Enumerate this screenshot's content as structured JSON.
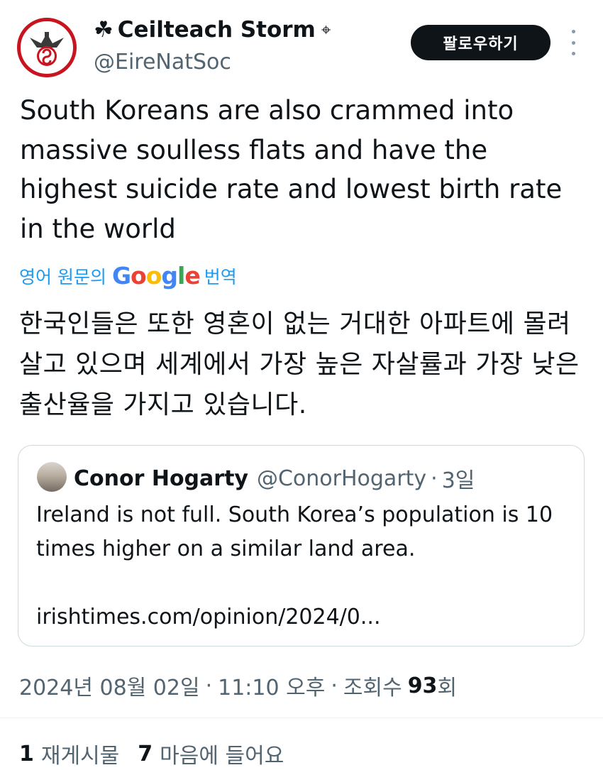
{
  "author": {
    "prefix_icon": "☘",
    "name": "Ceilteach Storm",
    "suffix_icon": "⌖",
    "handle": "@EireNatSoc"
  },
  "follow_button": {
    "label": "팔로우하기"
  },
  "tweet": {
    "text": "South Koreans are also crammed into massive soulless flats and have the highest suicide rate and lowest birth rate in the world",
    "translation_link": {
      "before": "영어 원문의",
      "brand": "Google",
      "after": "번역"
    },
    "translated_text": "한국인들은 또한 영혼이 없는 거대한 아파트에 몰려 살고 있으며 세계에서 가장 높은 자살률과 가장 낮은 출산율을 가지고 있습니다."
  },
  "quoted_tweet": {
    "name": "Conor Hogarty",
    "handle": "@ConorHogarty",
    "separator": "·",
    "time": "3일",
    "text": "Ireland is not full. South Korea’s population is 10 times higher on a similar land area.",
    "link": "irishtimes.com/opinion/2024/0..."
  },
  "meta": {
    "date": "2024년 08월 02일",
    "sep1": "·",
    "time": "11:10 오후",
    "sep2": "·",
    "views_label": "조회수",
    "views_count": "93",
    "views_unit": "회"
  },
  "stats": {
    "reposts_count": "1",
    "reposts_label": "재게시물",
    "likes_count": "7",
    "likes_label": "마음에 들어요"
  },
  "colors": {
    "accent": "#1d9bf0",
    "avatar_ring": "#c8141e",
    "text_primary": "#0f1419",
    "text_secondary": "#536471"
  },
  "icons": [
    "shamrock-icon",
    "crosshair-icon",
    "more-options-icon"
  ]
}
